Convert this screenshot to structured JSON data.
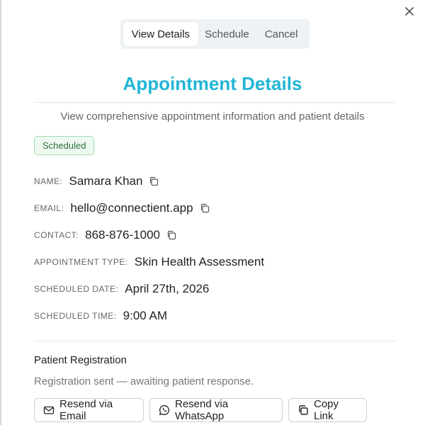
{
  "dialog": {
    "close_icon": "close-icon",
    "tabs": [
      {
        "label": "View Details",
        "active": true
      },
      {
        "label": "Schedule",
        "active": false
      },
      {
        "label": "Cancel",
        "active": false
      }
    ],
    "title": "Appointment Details",
    "subtitle": "View comprehensive appointment information and patient details",
    "status_badge": "Scheduled",
    "colors": {
      "title": "#22b5d6",
      "badge_bg": "#eefaf1",
      "badge_border": "#9fdcae",
      "badge_text": "#2f6e3d"
    }
  },
  "details": {
    "name": {
      "label": "NAME:",
      "value": "Samara Khan",
      "icon": "copy-icon"
    },
    "email": {
      "label": "EMAIL:",
      "value": "hello@connectient.app",
      "icon": "copy-icon"
    },
    "contact": {
      "label": "CONTACT:",
      "value": "868-876-1000",
      "icon": "copy-icon"
    },
    "appointment_type": {
      "label": "APPOINTMENT TYPE:",
      "value": "Skin Health Assessment"
    },
    "scheduled_date": {
      "label": "SCHEDULED DATE:",
      "value": "April 27th, 2026"
    },
    "scheduled_time": {
      "label": "SCHEDULED TIME:",
      "value": "9:00 AM"
    }
  },
  "registration": {
    "title": "Patient Registration",
    "status": "Registration sent — awaiting patient response.",
    "buttons": [
      {
        "label": "Resend via Email",
        "icon": "mail-icon"
      },
      {
        "label": "Resend via WhatsApp",
        "icon": "whatsapp-icon"
      },
      {
        "label": "Copy Link",
        "icon": "copy-icon"
      }
    ]
  }
}
